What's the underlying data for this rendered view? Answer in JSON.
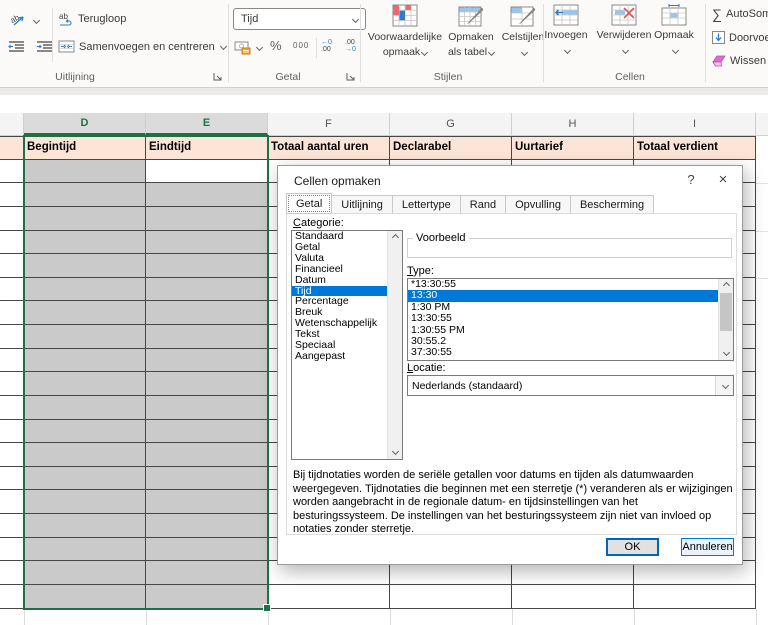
{
  "ribbon": {
    "groups": {
      "alignment": {
        "label": "Uitlijning",
        "wrap_label": "Terugloop",
        "merge_label": "Samenvoegen en centreren"
      },
      "number": {
        "label": "Getal",
        "format_value": "Tijd",
        "percent_label": "%",
        "thousands_label": "000"
      },
      "styles": {
        "label": "Stijlen",
        "conditional_line1": "Voorwaardelijke",
        "conditional_line2": "opmaak",
        "format_table_line1": "Opmaken",
        "format_table_line2": "als tabel",
        "cell_styles_label": "Celstijlen"
      },
      "cells": {
        "label": "Cellen",
        "insert_label": "Invoegen",
        "delete_label": "Verwijderen",
        "format_label": "Opmaak"
      },
      "editing": {
        "autosum_label": "AutoSom",
        "fill_label": "Doorvoeren",
        "clear_label": "Wissen"
      }
    }
  },
  "sheet": {
    "column_letters": [
      "D",
      "E",
      "F",
      "G",
      "H",
      "I"
    ],
    "header_row": [
      "Begintijd",
      "Eindtijd",
      "Totaal aantal uren",
      "Declarabel",
      "Uurtarief",
      "Totaal verdient"
    ],
    "selected_columns": [
      "D",
      "E"
    ],
    "data_row_count": 19
  },
  "dialog": {
    "title": "Cellen opmaken",
    "help_label": "?",
    "close_label": "×",
    "tabs": [
      "Getal",
      "Uitlijning",
      "Lettertype",
      "Rand",
      "Opvulling",
      "Bescherming"
    ],
    "active_tab": "Getal",
    "category_label": "Categorie:",
    "categories": [
      "Standaard",
      "Getal",
      "Valuta",
      "Financieel",
      "Datum",
      "Tijd",
      "Percentage",
      "Breuk",
      "Wetenschappelijk",
      "Tekst",
      "Speciaal",
      "Aangepast"
    ],
    "selected_category": "Tijd",
    "preview_label": "Voorbeeld",
    "type_label": "Type:",
    "types": [
      "*13:30:55",
      "13:30",
      "1:30 PM",
      "13:30:55",
      "1:30:55 PM",
      "30:55.2",
      "37:30:55"
    ],
    "selected_type": "13:30",
    "locale_label": "Locatie:",
    "locale_value": "Nederlands (standaard)",
    "description": "Bij tijdnotaties worden de seriële getallen voor datums en tijden als datumwaarden weergegeven. Tijdnotaties die beginnen met een sterretje (*) veranderen als er wijzigingen worden aangebracht in de regionale datum- en tijdsinstellingen van het besturingssysteem. De instellingen van het besturingssysteem zijn niet van invloed op notaties zonder sterretje.",
    "ok_label": "OK",
    "cancel_label": "Annuleren"
  },
  "colors": {
    "accent_green": "#1e7145",
    "selection_blue": "#0078d7",
    "table_header_fill": "#fce4d6",
    "selection_gray": "#cacaca",
    "icon_blue": "#2b7cd3",
    "icon_red": "#e86a73",
    "eraser_pink": "#d86ecc"
  }
}
